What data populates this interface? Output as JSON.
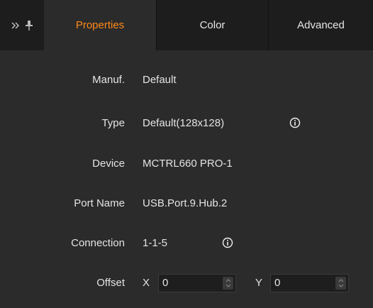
{
  "tabs": [
    {
      "label": "Properties",
      "active": true
    },
    {
      "label": "Color",
      "active": false
    },
    {
      "label": "Advanced",
      "active": false
    }
  ],
  "icons": {
    "expand": "double-chevron-right-icon",
    "pin": "pin-icon",
    "info": "info-icon"
  },
  "colors": {
    "active_tab": "#ff8a1a",
    "background": "#2b2b2b",
    "tabbar": "#1d1d1d"
  },
  "fields": {
    "manufacturer": {
      "label": "Manuf.",
      "value": "Default"
    },
    "type": {
      "label": "Type",
      "value": "Default(128x128)"
    },
    "device": {
      "label": "Device",
      "value": "MCTRL660 PRO-1"
    },
    "port_name": {
      "label": "Port Name",
      "value": "USB.Port.9.Hub.2"
    },
    "connection": {
      "label": "Connection",
      "value": "1-1-5"
    },
    "offset": {
      "label": "Offset",
      "x_label": "X",
      "x_value": "0",
      "y_label": "Y",
      "y_value": "0"
    }
  }
}
